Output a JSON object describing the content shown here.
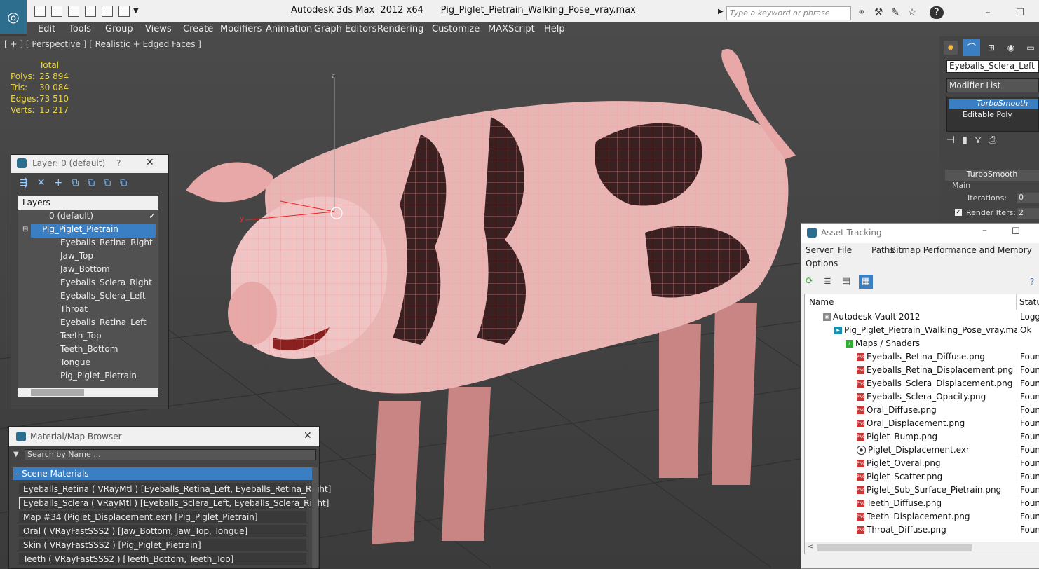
{
  "app": {
    "title": "Autodesk 3ds Max  2012 x64      Pig_Piglet_Pietrain_Walking_Pose_vray.max",
    "search_placeholder": "Type a keyword or phrase"
  },
  "menu": [
    "Edit",
    "Tools",
    "Group",
    "Views",
    "Create",
    "Modifiers",
    "Animation",
    "Graph Editors",
    "Rendering",
    "Customize",
    "MAXScript",
    "Help"
  ],
  "viewport": {
    "label": "[ + ] [ Perspective ] [ Realistic + Edged Faces ]",
    "stats_header": "Total",
    "stats": [
      {
        "label": "Polys:",
        "value": "25 894"
      },
      {
        "label": "Tris:",
        "value": "30 084"
      },
      {
        "label": "Edges:",
        "value": "73 510"
      },
      {
        "label": "Verts:",
        "value": "15 217"
      }
    ],
    "axis_z": "z",
    "axis_y": "y"
  },
  "command_panel": {
    "object_name": "Eyeballs_Sclera_Left",
    "modifier_list": "Modifier List",
    "stack": [
      "TurboSmooth",
      "Editable Poly"
    ],
    "rollout_title": "TurboSmooth",
    "group_main": "Main",
    "iterations_label": "Iterations:",
    "iterations_value": "0",
    "render_iters_label": "Render Iters:",
    "render_iters_value": "2"
  },
  "layer_dialog": {
    "title": "Layer: 0 (default)",
    "help": "?",
    "column_header": "Layers",
    "rows": [
      {
        "label": "0 (default)",
        "level": 0
      },
      {
        "label": "Pig_Piglet_Pietrain",
        "level": 0
      },
      {
        "label": "Eyeballs_Retina_Right",
        "level": 1
      },
      {
        "label": "Jaw_Top",
        "level": 1
      },
      {
        "label": "Jaw_Bottom",
        "level": 1
      },
      {
        "label": "Eyeballs_Sclera_Right",
        "level": 1
      },
      {
        "label": "Eyeballs_Sclera_Left",
        "level": 1
      },
      {
        "label": "Throat",
        "level": 1
      },
      {
        "label": "Eyeballs_Retina_Left",
        "level": 1
      },
      {
        "label": "Teeth_Top",
        "level": 1
      },
      {
        "label": "Teeth_Bottom",
        "level": 1
      },
      {
        "label": "Tongue",
        "level": 1
      },
      {
        "label": "Pig_Piglet_Pietrain",
        "level": 1
      }
    ]
  },
  "material_browser": {
    "title": "Material/Map Browser",
    "search_placeholder": "Search by Name ...",
    "section": "- Scene Materials",
    "items": [
      "Eyeballs_Retina  ( VRayMtl )  [Eyeballs_Retina_Left, Eyeballs_Retina_Right]",
      "Eyeballs_Sclera  ( VRayMtl )  [Eyeballs_Sclera_Left, Eyeballs_Sclera_Right]",
      "Map #34 (Piglet_Displacement.exr)  [Pig_Piglet_Pietrain]",
      "Oral  ( VRayFastSSS2 )  [Jaw_Bottom, Jaw_Top, Tongue]",
      "Skin  ( VRayFastSSS2 )  [Pig_Piglet_Pietrain]",
      "Teeth  ( VRayFastSSS2 )  [Teeth_Bottom, Teeth_Top]"
    ]
  },
  "asset_tracking": {
    "title": "Asset Tracking",
    "menu": [
      "Server",
      "File",
      "Paths",
      "Bitmap Performance and Memory",
      "Options"
    ],
    "col_name": "Name",
    "col_status": "Status",
    "rows": [
      {
        "name": "Autodesk Vault 2012",
        "status": "Logge",
        "indent": 1,
        "icon": "vault"
      },
      {
        "name": "Pig_Piglet_Pietrain_Walking_Pose_vray.max",
        "status": "Ok",
        "indent": 2,
        "icon": "max"
      },
      {
        "name": "Maps / Shaders",
        "status": "",
        "indent": 3,
        "icon": "maps"
      },
      {
        "name": "Eyeballs_Retina_Diffuse.png",
        "status": "Found",
        "indent": 4,
        "icon": "png"
      },
      {
        "name": "Eyeballs_Retina_Displacement.png",
        "status": "Found",
        "indent": 4,
        "icon": "png"
      },
      {
        "name": "Eyeballs_Sclera_Displacement.png",
        "status": "Found",
        "indent": 4,
        "icon": "png"
      },
      {
        "name": "Eyeballs_Sclera_Opacity.png",
        "status": "Found",
        "indent": 4,
        "icon": "png"
      },
      {
        "name": "Oral_Diffuse.png",
        "status": "Found",
        "indent": 4,
        "icon": "png"
      },
      {
        "name": "Oral_Displacement.png",
        "status": "Found",
        "indent": 4,
        "icon": "png"
      },
      {
        "name": "Piglet_Bump.png",
        "status": "Found",
        "indent": 4,
        "icon": "png"
      },
      {
        "name": "Piglet_Displacement.exr",
        "status": "Found",
        "indent": 4,
        "icon": "exr"
      },
      {
        "name": "Piglet_Overal.png",
        "status": "Found",
        "indent": 4,
        "icon": "png"
      },
      {
        "name": "Piglet_Scatter.png",
        "status": "Found",
        "indent": 4,
        "icon": "png"
      },
      {
        "name": "Piglet_Sub_Surface_Pietrain.png",
        "status": "Found",
        "indent": 4,
        "icon": "png"
      },
      {
        "name": "Teeth_Diffuse.png",
        "status": "Found",
        "indent": 4,
        "icon": "png"
      },
      {
        "name": "Teeth_Displacement.png",
        "status": "Found",
        "indent": 4,
        "icon": "png"
      },
      {
        "name": "Throat_Diffuse.png",
        "status": "Found",
        "indent": 4,
        "icon": "png"
      }
    ]
  }
}
